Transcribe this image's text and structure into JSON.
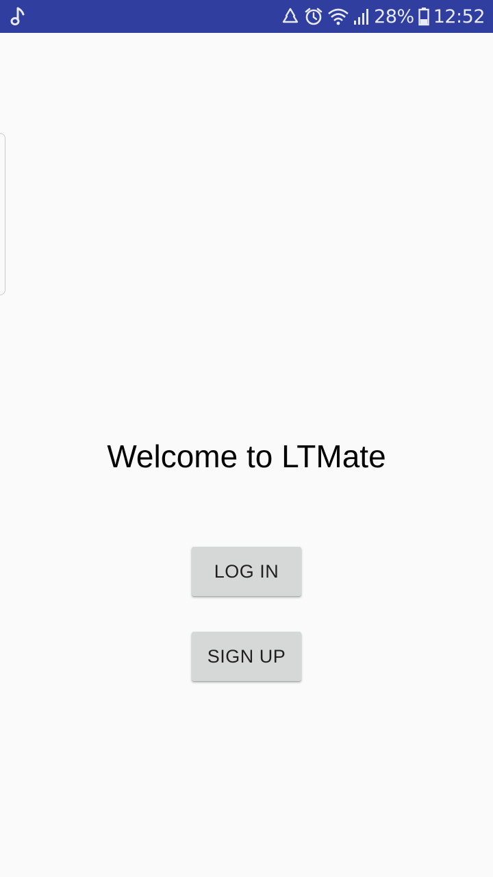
{
  "status_bar": {
    "background": "#303f9f",
    "left_icons": [
      "music-note-icon"
    ],
    "right_icons": [
      "recycle-icon",
      "alarm-icon",
      "wifi-icon",
      "signal-icon",
      "battery-icon"
    ],
    "battery_percent": "28%",
    "time": "12:52"
  },
  "main": {
    "welcome_text": "Welcome to LTMate",
    "login_label": "LOG IN",
    "signup_label": "SIGN UP",
    "button_color": "#d6d7d7",
    "background": "#fafafa"
  }
}
